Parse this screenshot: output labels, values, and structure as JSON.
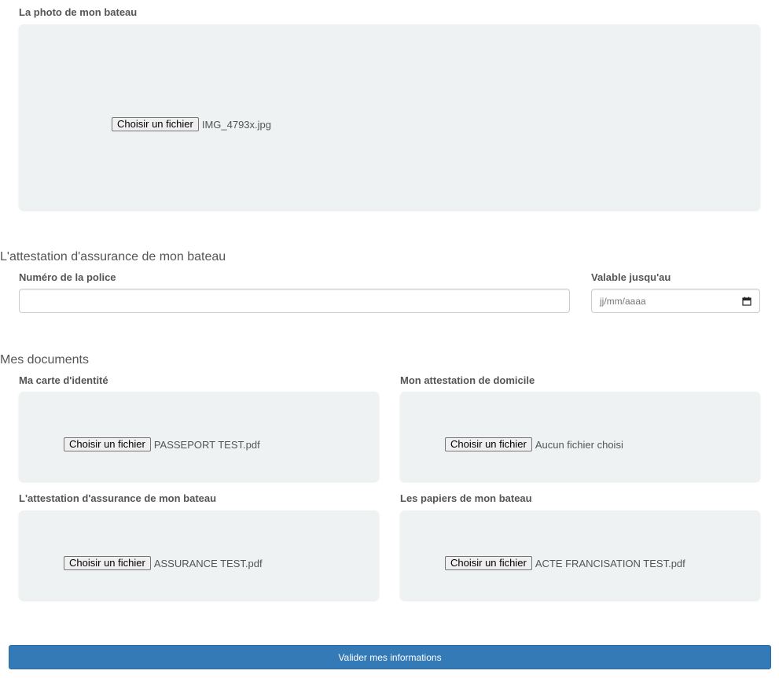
{
  "boat_photo": {
    "label": "La photo de mon bateau",
    "button_label": "Choisir un fichier",
    "file_name": "IMG_4793x.jpg"
  },
  "insurance": {
    "section_title": "L'attestation d'assurance de mon bateau",
    "policy_number_label": "Numéro de la police",
    "policy_number_value": "",
    "valid_until_label": "Valable jusqu'au",
    "valid_until_placeholder": "jj/mm/aaaa"
  },
  "documents": {
    "section_title": "Mes documents",
    "items": [
      {
        "label": "Ma carte d'identité",
        "button_label": "Choisir un fichier",
        "file_name": "PASSEPORT TEST.pdf"
      },
      {
        "label": "Mon attestation de domicile",
        "button_label": "Choisir un fichier",
        "file_name": "Aucun fichier choisi"
      },
      {
        "label": "L'attestation d'assurance de mon bateau",
        "button_label": "Choisir un fichier",
        "file_name": "ASSURANCE TEST.pdf"
      },
      {
        "label": "Les papiers de mon bateau",
        "button_label": "Choisir un fichier",
        "file_name": "ACTE FRANCISATION TEST.pdf"
      }
    ]
  },
  "submit_label": "Valider mes informations",
  "colors": {
    "dropzone_bg": "#eef2f2",
    "primary_button": "#337ab7"
  }
}
